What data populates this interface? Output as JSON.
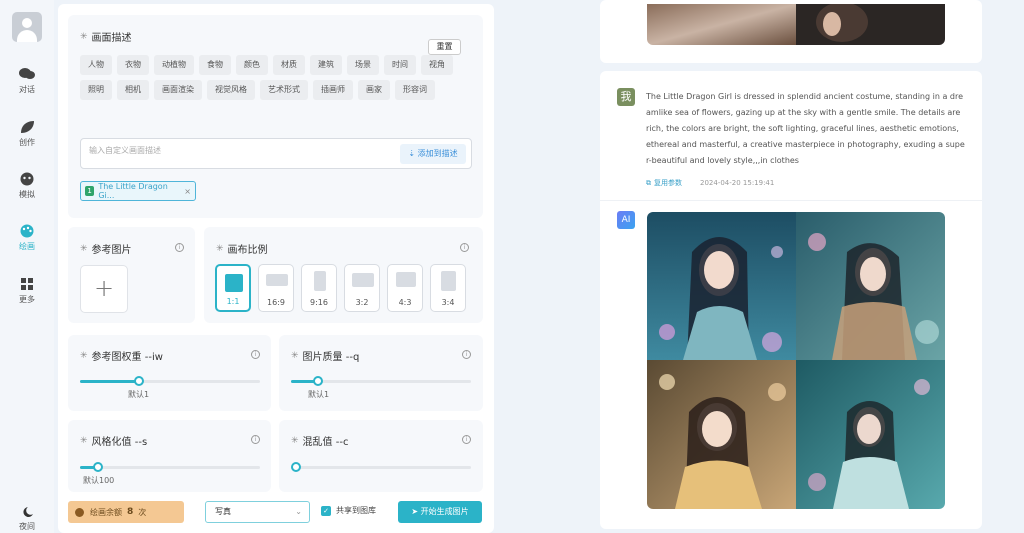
{
  "sidebar": {
    "items": [
      {
        "label": "对话",
        "icon": "chat-icon"
      },
      {
        "label": "创作",
        "icon": "leaf-icon"
      },
      {
        "label": "模拟",
        "icon": "drama-icon"
      },
      {
        "label": "绘画",
        "icon": "palette-icon"
      },
      {
        "label": "更多",
        "icon": "grid-icon"
      }
    ],
    "night_label": "夜间"
  },
  "describe": {
    "title": "画面描述",
    "reset_label": "重置",
    "tags": [
      "人物",
      "衣物",
      "动植物",
      "食物",
      "颜色",
      "材质",
      "建筑",
      "场景",
      "时间",
      "视角",
      "照明",
      "相机",
      "画面渲染",
      "视觉风格",
      "艺术形式",
      "插画师",
      "画家",
      "形容词"
    ],
    "placeholder": "输入自定义画面描述",
    "add_label": "添加到描述",
    "chip": {
      "num": "1",
      "text": "The Little Dragon Gi..."
    }
  },
  "reference": {
    "title": "参考图片"
  },
  "ratio": {
    "title": "画布比例",
    "options": [
      "1:1",
      "16:9",
      "9:16",
      "3:2",
      "4:3",
      "3:4"
    ],
    "selected": "1:1"
  },
  "iw": {
    "title": "参考图权重 --iw",
    "default": "默认1",
    "value": 0.33
  },
  "quality": {
    "title": "图片质量 --q",
    "default": "默认1",
    "value": 0.15
  },
  "stylize": {
    "title": "风格化值 --s",
    "default": "默认100",
    "value": 0.1
  },
  "chaos": {
    "title": "混乱值 --c",
    "value": 0.0
  },
  "bottom": {
    "balance_label": "绘画余额",
    "balance_count": "8",
    "balance_unit": "次",
    "style_select": "写真",
    "share_label": "共享到图库",
    "generate_label": "开始生成图片"
  },
  "chat": {
    "user_avatar": "我",
    "prompt": "The Little Dragon Girl is dressed in splendid ancient costume, standing in a dreamlike sea of flowers, gazing up at the sky with a gentle smile. The details are rich, the colors are bright, the soft lighting, graceful lines, aesthetic emotions, ethereal and masterful, a creative masterpiece in photography, exuding a super-beautiful and lovely style,,,in clothes",
    "reuse_label": "复用参数",
    "timestamp": "2024-04-20 15:19:41",
    "ai_avatar": "AI"
  },
  "colors": {
    "accent": "#2bb3c8",
    "balance_bg": "#f4c893"
  }
}
